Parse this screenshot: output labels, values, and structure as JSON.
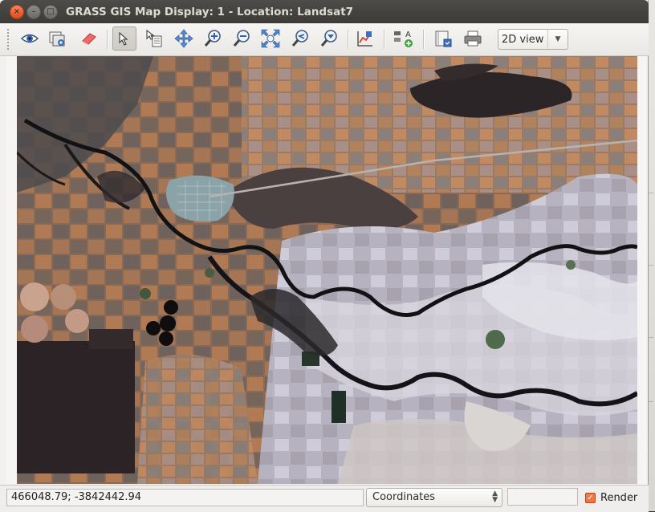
{
  "window": {
    "title": "GRASS GIS Map Display: 1  - Location: Landsat7",
    "controls": {
      "close": "×",
      "minimize": "–",
      "maximize": "□"
    }
  },
  "toolbar": {
    "tools": [
      {
        "id": "display",
        "icon": "eye-icon"
      },
      {
        "id": "render",
        "icon": "render-map-icon"
      },
      {
        "id": "erase",
        "icon": "eraser-icon"
      },
      {
        "id": "pointer",
        "icon": "pointer-icon",
        "active": true
      },
      {
        "id": "query",
        "icon": "query-icon"
      },
      {
        "id": "pan",
        "icon": "pan-icon"
      },
      {
        "id": "zoom-in",
        "icon": "zoom-in-icon"
      },
      {
        "id": "zoom-out",
        "icon": "zoom-out-icon"
      },
      {
        "id": "zoom-extent",
        "icon": "zoom-extent-icon"
      },
      {
        "id": "zoom-back",
        "icon": "zoom-back-icon"
      },
      {
        "id": "zoom-menu",
        "icon": "zoom-menu-icon"
      },
      {
        "id": "analyze",
        "icon": "analyze-icon"
      },
      {
        "id": "overlay",
        "icon": "decoration-icon"
      },
      {
        "id": "save",
        "icon": "save-map-icon"
      },
      {
        "id": "print",
        "icon": "print-icon"
      }
    ],
    "view_mode": {
      "selected": "2D view"
    }
  },
  "statusbar": {
    "coordinates": "466048.79; -3842442.94",
    "mode": {
      "selected": "Coordinates"
    },
    "render_label": "Render",
    "render_checked": true
  },
  "colors": {
    "titlebar": "#3c3b37",
    "close_button": "#e9541e",
    "accent": "#f07746"
  }
}
